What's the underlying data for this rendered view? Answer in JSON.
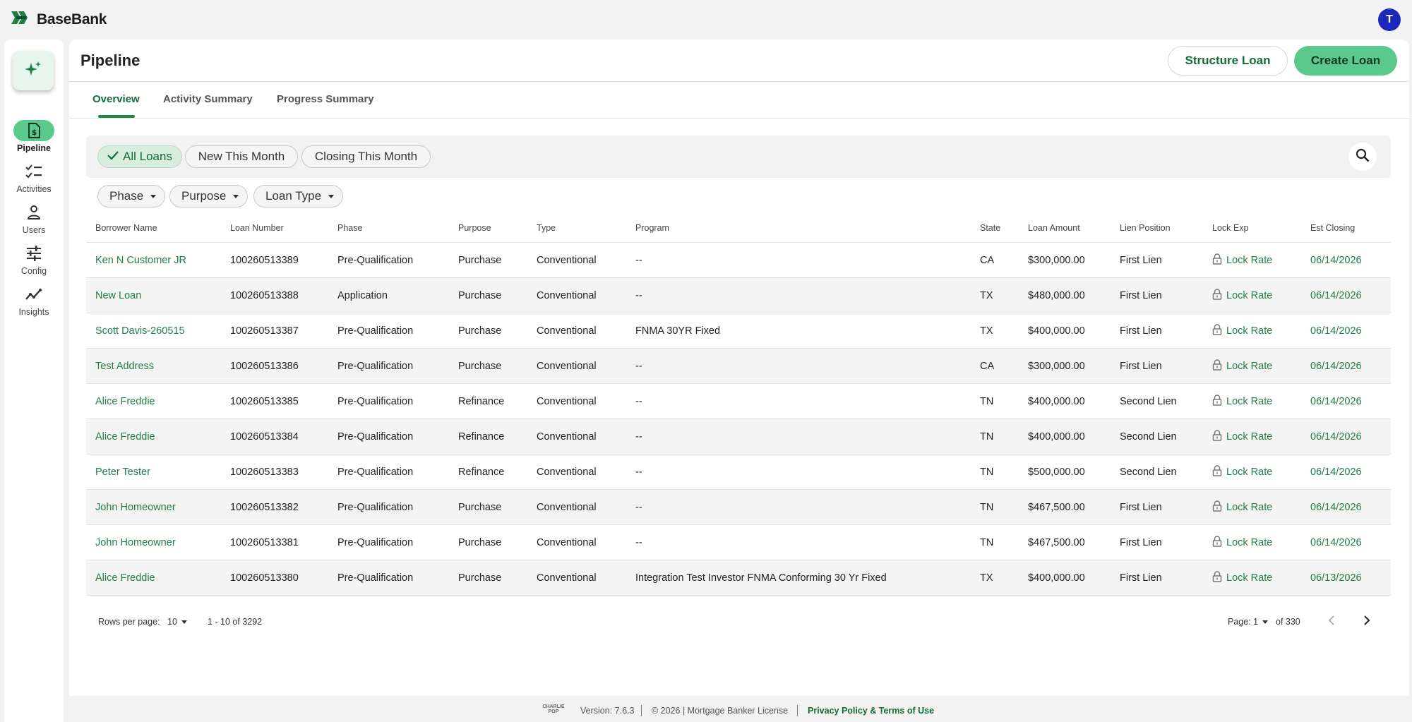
{
  "app": {
    "brand_name": "BaseBank",
    "user_initial": "T"
  },
  "sidebar": {
    "items": [
      {
        "label": "Pipeline",
        "icon": "pipeline-doc-icon",
        "active": true
      },
      {
        "label": "Activities",
        "icon": "checklist-icon",
        "active": false
      },
      {
        "label": "Users",
        "icon": "user-icon",
        "active": false
      },
      {
        "label": "Config",
        "icon": "sliders-icon",
        "active": false
      },
      {
        "label": "Insights",
        "icon": "trend-icon",
        "active": false
      }
    ]
  },
  "header": {
    "title": "Pipeline",
    "structure_button": "Structure Loan",
    "create_button": "Create Loan"
  },
  "tabs": [
    {
      "label": "Overview",
      "active": true
    },
    {
      "label": "Activity Summary",
      "active": false
    },
    {
      "label": "Progress Summary",
      "active": false
    }
  ],
  "quick_filters": [
    {
      "label": "All Loans",
      "selected": true
    },
    {
      "label": "New This Month",
      "selected": false
    },
    {
      "label": "Closing This Month",
      "selected": false
    }
  ],
  "dropdown_filters": [
    "Phase",
    "Purpose",
    "Loan Type"
  ],
  "table": {
    "columns": [
      "Borrower Name",
      "Loan Number",
      "Phase",
      "Purpose",
      "Type",
      "Program",
      "State",
      "Loan Amount",
      "Lien Position",
      "Lock Exp",
      "Est Closing"
    ],
    "lock_label": "Lock Rate",
    "rows": [
      {
        "borrower": "Ken N Customer JR",
        "loan_number": "100260513389",
        "phase": "Pre-Qualification",
        "purpose": "Purchase",
        "type": "Conventional",
        "program": "--",
        "state": "CA",
        "amount": "$300,000.00",
        "lien": "First Lien",
        "closing": "06/14/2026"
      },
      {
        "borrower": "New Loan",
        "loan_number": "100260513388",
        "phase": "Application",
        "purpose": "Purchase",
        "type": "Conventional",
        "program": "--",
        "state": "TX",
        "amount": "$480,000.00",
        "lien": "First Lien",
        "closing": "06/14/2026"
      },
      {
        "borrower": "Scott Davis-260515",
        "loan_number": "100260513387",
        "phase": "Pre-Qualification",
        "purpose": "Purchase",
        "type": "Conventional",
        "program": "FNMA 30YR Fixed",
        "state": "TX",
        "amount": "$400,000.00",
        "lien": "First Lien",
        "closing": "06/14/2026"
      },
      {
        "borrower": "Test Address",
        "loan_number": "100260513386",
        "phase": "Pre-Qualification",
        "purpose": "Purchase",
        "type": "Conventional",
        "program": "--",
        "state": "CA",
        "amount": "$300,000.00",
        "lien": "First Lien",
        "closing": "06/14/2026"
      },
      {
        "borrower": "Alice Freddie",
        "loan_number": "100260513385",
        "phase": "Pre-Qualification",
        "purpose": "Refinance",
        "type": "Conventional",
        "program": "--",
        "state": "TN",
        "amount": "$400,000.00",
        "lien": "Second Lien",
        "closing": "06/14/2026"
      },
      {
        "borrower": "Alice Freddie",
        "loan_number": "100260513384",
        "phase": "Pre-Qualification",
        "purpose": "Refinance",
        "type": "Conventional",
        "program": "--",
        "state": "TN",
        "amount": "$400,000.00",
        "lien": "Second Lien",
        "closing": "06/14/2026"
      },
      {
        "borrower": "Peter Tester",
        "loan_number": "100260513383",
        "phase": "Pre-Qualification",
        "purpose": "Refinance",
        "type": "Conventional",
        "program": "--",
        "state": "TN",
        "amount": "$500,000.00",
        "lien": "Second Lien",
        "closing": "06/14/2026"
      },
      {
        "borrower": "John Homeowner",
        "loan_number": "100260513382",
        "phase": "Pre-Qualification",
        "purpose": "Purchase",
        "type": "Conventional",
        "program": "--",
        "state": "TN",
        "amount": "$467,500.00",
        "lien": "First Lien",
        "closing": "06/14/2026"
      },
      {
        "borrower": "John Homeowner",
        "loan_number": "100260513381",
        "phase": "Pre-Qualification",
        "purpose": "Purchase",
        "type": "Conventional",
        "program": "--",
        "state": "TN",
        "amount": "$467,500.00",
        "lien": "First Lien",
        "closing": "06/14/2026"
      },
      {
        "borrower": "Alice Freddie",
        "loan_number": "100260513380",
        "phase": "Pre-Qualification",
        "purpose": "Purchase",
        "type": "Conventional",
        "program": "Integration Test Investor FNMA Conforming 30 Yr Fixed",
        "state": "TX",
        "amount": "$400,000.00",
        "lien": "First Lien",
        "closing": "06/13/2026"
      }
    ]
  },
  "pagination": {
    "rows_per_page_label": "Rows per page:",
    "rows_per_page": "10",
    "range": "1 - 10 of 3292",
    "page_label": "Page: 1",
    "of_pages": "of 330"
  },
  "footer": {
    "logo_text": "CHARLIE POP",
    "version": "Version: 7.6.3",
    "copyright": "© 2026 | Mortgage Banker License",
    "privacy_link": "Privacy Policy & Terms of Use"
  },
  "colors": {
    "brand_green": "#1f7f45",
    "accent_green": "#5bc98b",
    "avatar_blue": "#1e27b8"
  }
}
